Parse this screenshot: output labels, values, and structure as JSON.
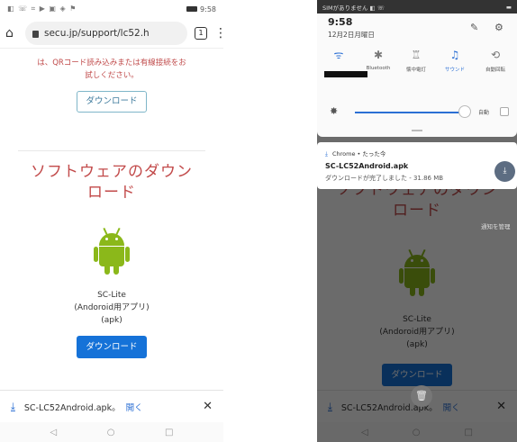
{
  "left": {
    "status": {
      "icons": "◧ ☏ ⌗ ▶ ▣ ◈ ⚑",
      "time": "9:58"
    },
    "url": "secu.jp/support/lc52.h",
    "tabs_count": "1",
    "warn_lines": [
      "は、QRコード読み込みまたは有線接続をお",
      "試しください。"
    ],
    "download_outline": "ダウンロード",
    "title_lines": [
      "ソフトウェアのダウン",
      "ロード"
    ],
    "app_lines": [
      "SC-Lite",
      "(Andoroid用アプリ)",
      "(apk)"
    ],
    "download_solid": "ダウンロード",
    "dl_bar": {
      "file": "SC-LC52Android.apk。",
      "open": "開く",
      "close": "✕"
    },
    "nav": {
      "back": "◁",
      "home": "○",
      "recent": "□"
    }
  },
  "right": {
    "status": {
      "left": "SIMがありません ◧ ☏",
      "battery": "▬"
    },
    "time": "9:58",
    "date": "12月2日月曜日",
    "qs": [
      {
        "icon": "wifi-icon",
        "glyph": "ᯤ",
        "label": "",
        "on": true
      },
      {
        "icon": "bluetooth-icon",
        "glyph": "✱",
        "label": "Bluetooth",
        "on": false
      },
      {
        "icon": "flashlight-icon",
        "glyph": "♖",
        "label": "懐中電灯",
        "on": false
      },
      {
        "icon": "sound-icon",
        "glyph": "♫",
        "label": "サウンド",
        "on": true
      },
      {
        "icon": "rotate-icon",
        "glyph": "⟲",
        "label": "自動回転",
        "on": false
      }
    ],
    "brightness_auto": "自動",
    "notif": {
      "app": "Chrome • たった今",
      "title": "SC-LC52Android.apk",
      "body": "ダウンロードが完了しました - 31.86 MB"
    },
    "manage": "通知を管理"
  }
}
